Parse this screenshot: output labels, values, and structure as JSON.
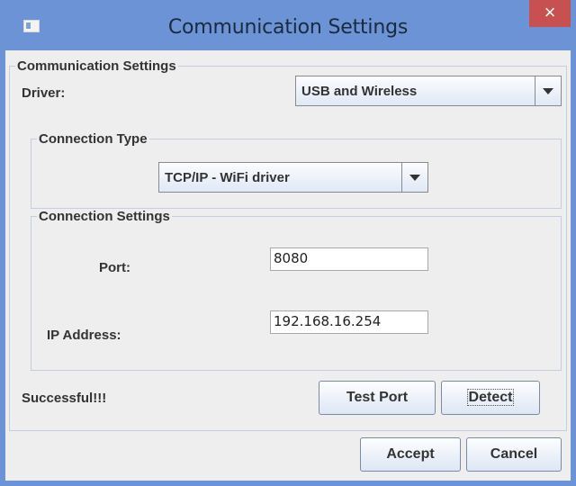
{
  "window": {
    "title": "Communication Settings",
    "close_glyph": "×"
  },
  "main_group": {
    "legend": "Communication Settings",
    "driver_label": "Driver:",
    "driver_value": "USB and Wireless"
  },
  "connection_type": {
    "legend": "Connection Type",
    "value": "TCP/IP - WiFi driver"
  },
  "connection_settings": {
    "legend": "Connection Settings",
    "port_label": "Port:",
    "port_value": "8080",
    "ip_label": "IP Address:",
    "ip_value": "192.168.16.254"
  },
  "status": {
    "text": "Successful!!!"
  },
  "buttons": {
    "test_port": "Test Port",
    "detect": "Detect",
    "accept": "Accept",
    "cancel": "Cancel"
  }
}
